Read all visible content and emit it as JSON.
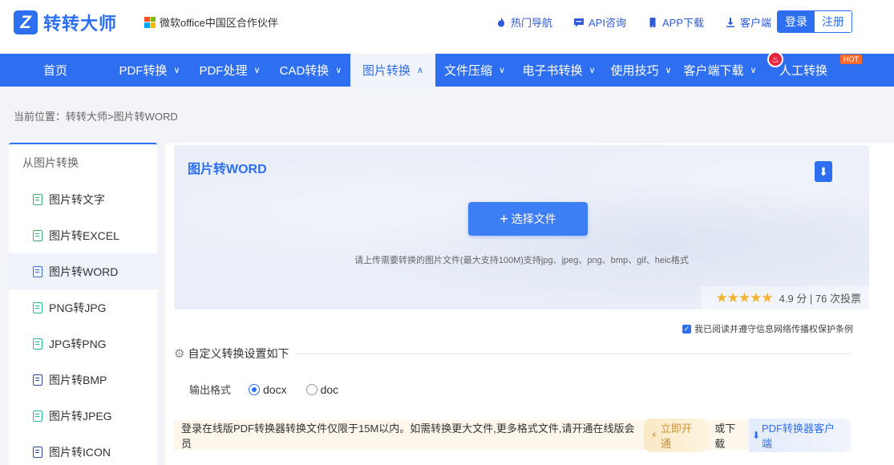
{
  "header": {
    "logo_mark": "Z",
    "logo_text": "转转大师",
    "partner": "微软office中国区合作伙伴",
    "links": [
      {
        "label": "热门导航",
        "icon": "flame-icon"
      },
      {
        "label": "API咨询",
        "icon": "chat-icon"
      },
      {
        "label": "APP下载",
        "icon": "phone-icon"
      },
      {
        "label": "客户端",
        "icon": "download-icon"
      }
    ],
    "login": "登录",
    "register": "注册"
  },
  "nav": {
    "items": [
      {
        "label": "首页",
        "chevron": "",
        "width": 138
      },
      {
        "label": "PDF转换",
        "chevron": "∨",
        "width": 97
      },
      {
        "label": "PDF处理",
        "chevron": "∨",
        "width": 103
      },
      {
        "label": "CAD转换",
        "chevron": "∨",
        "width": 99
      },
      {
        "label": "图片转换",
        "chevron": "∧",
        "width": 106
      },
      {
        "label": "文件压缩",
        "chevron": "∨",
        "width": 98
      },
      {
        "label": "电子书转换",
        "chevron": "∨",
        "width": 112
      },
      {
        "label": "使用技巧",
        "chevron": "∨",
        "width": 93
      },
      {
        "label": "客户端下载",
        "chevron": "∨",
        "width": 104
      },
      {
        "label": "人工转换",
        "chevron": "",
        "width": 104
      }
    ],
    "active_index": 4,
    "hot": "HOT"
  },
  "breadcrumb": "当前位置：转转大师>图片转WORD",
  "sidebar": {
    "title": "从图片转换",
    "items": [
      {
        "label": "图片转文字",
        "color": "green"
      },
      {
        "label": "图片转EXCEL",
        "color": "green"
      },
      {
        "label": "图片转WORD",
        "color": "blue"
      },
      {
        "label": "PNG转JPG",
        "color": "teal"
      },
      {
        "label": "JPG转PNG",
        "color": "teal"
      },
      {
        "label": "图片转BMP",
        "color": "navy"
      },
      {
        "label": "图片转JPEG",
        "color": "teal"
      },
      {
        "label": "图片转ICON",
        "color": "navy"
      }
    ],
    "active_index": 2
  },
  "upload": {
    "title": "图片转WORD",
    "button": "选择文件",
    "hint": "请上传需要转换的图片文件(最大支持100M)支持jpg、jpeg、png、bmp、gif、heic格式",
    "stars": "★★★★★",
    "rating": "4.9 分 | 76 次投票"
  },
  "agree": "我已阅读并遵守信息网络传播权保护条例",
  "settings": {
    "title": "自定义转换设置如下",
    "format_label": "输出格式",
    "options": [
      "docx",
      "doc"
    ],
    "selected": "docx"
  },
  "notice": {
    "text": "登录在线版PDF转换器转换文件仅限于15M以内。如需转换更大文件,更多格式文件,请开通在线版会员",
    "vip": "立即开通",
    "or": "或下载",
    "client": "PDF转换器客户端"
  }
}
